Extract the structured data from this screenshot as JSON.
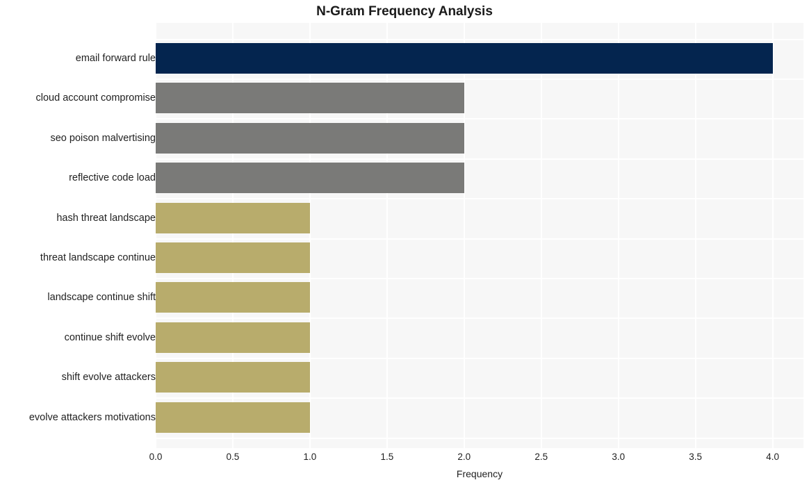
{
  "chart_data": {
    "type": "bar",
    "orientation": "horizontal",
    "title": "N-Gram Frequency Analysis",
    "xlabel": "Frequency",
    "ylabel": "",
    "categories": [
      "email forward rule",
      "cloud account compromise",
      "seo poison malvertising",
      "reflective code load",
      "hash threat landscape",
      "threat landscape continue",
      "landscape continue shift",
      "continue shift evolve",
      "shift evolve attackers",
      "evolve attackers motivations"
    ],
    "values": [
      4,
      2,
      2,
      2,
      1,
      1,
      1,
      1,
      1,
      1
    ],
    "bar_colors": [
      "#04254f",
      "#7a7a78",
      "#7a7a78",
      "#7a7a78",
      "#b8ac6c",
      "#b8ac6c",
      "#b8ac6c",
      "#b8ac6c",
      "#b8ac6c",
      "#b8ac6c"
    ],
    "xlim": [
      0,
      4.2
    ],
    "xticks": [
      0,
      0.5,
      1,
      1.5,
      2,
      2.5,
      3,
      3.5,
      4
    ],
    "xticklabels": [
      "0.0",
      "0.5",
      "1.0",
      "1.5",
      "2.0",
      "2.5",
      "3.0",
      "3.5",
      "4.0"
    ],
    "grid": true,
    "grid_color": "#ffffff",
    "plot_background": "#f7f7f7",
    "figure_background": "#ffffff",
    "legend": null
  }
}
